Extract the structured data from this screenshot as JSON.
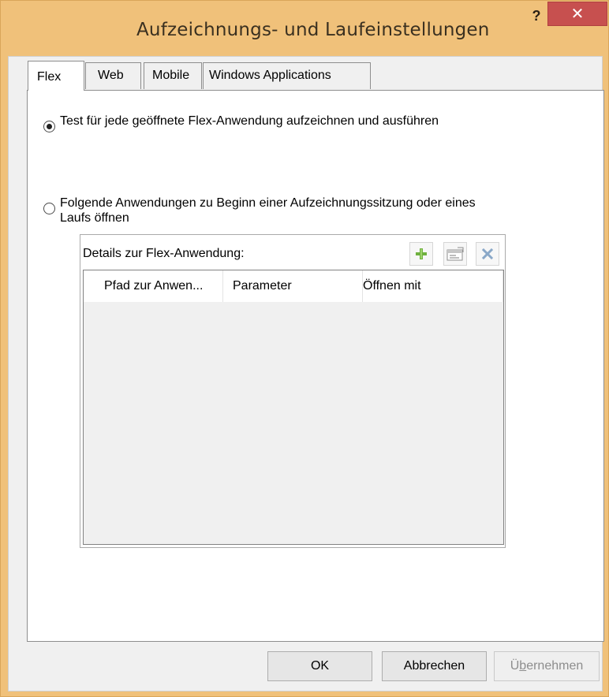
{
  "window": {
    "title": "Aufzeichnungs- und Laufeinstellungen",
    "help_label": "?",
    "close_label": "✕"
  },
  "tabs": [
    {
      "label": "Flex",
      "active": true
    },
    {
      "label": "Web",
      "active": false
    },
    {
      "label": "Mobile",
      "active": false
    },
    {
      "label": "Windows Applications",
      "active": false
    }
  ],
  "options": {
    "record_each_app": {
      "label": "Test für jede geöffnete Flex-Anwendung aufzeichnen und ausführen",
      "checked": true
    },
    "open_following_apps": {
      "label": "Folgende Anwendungen zu Beginn einer Aufzeichnungssitzung oder eines Laufs öffnen",
      "checked": false
    }
  },
  "details": {
    "title": "Details zur Flex-Anwendung:",
    "toolbar": [
      "add-icon",
      "properties-icon",
      "delete-icon"
    ],
    "columns": [
      "Pfad zur Anwen...",
      "Parameter",
      "Öffnen mit"
    ],
    "rows": []
  },
  "buttons": {
    "ok": "OK",
    "cancel": "Abbrechen",
    "apply_prefix": "Ü",
    "apply_underlined": "b",
    "apply_suffix": "ernehmen"
  },
  "colors": {
    "titlebar": "#f0c17a",
    "close_button": "#c7504f",
    "add_icon": "#6fb13f",
    "delete_icon": "#8aa8c8"
  }
}
